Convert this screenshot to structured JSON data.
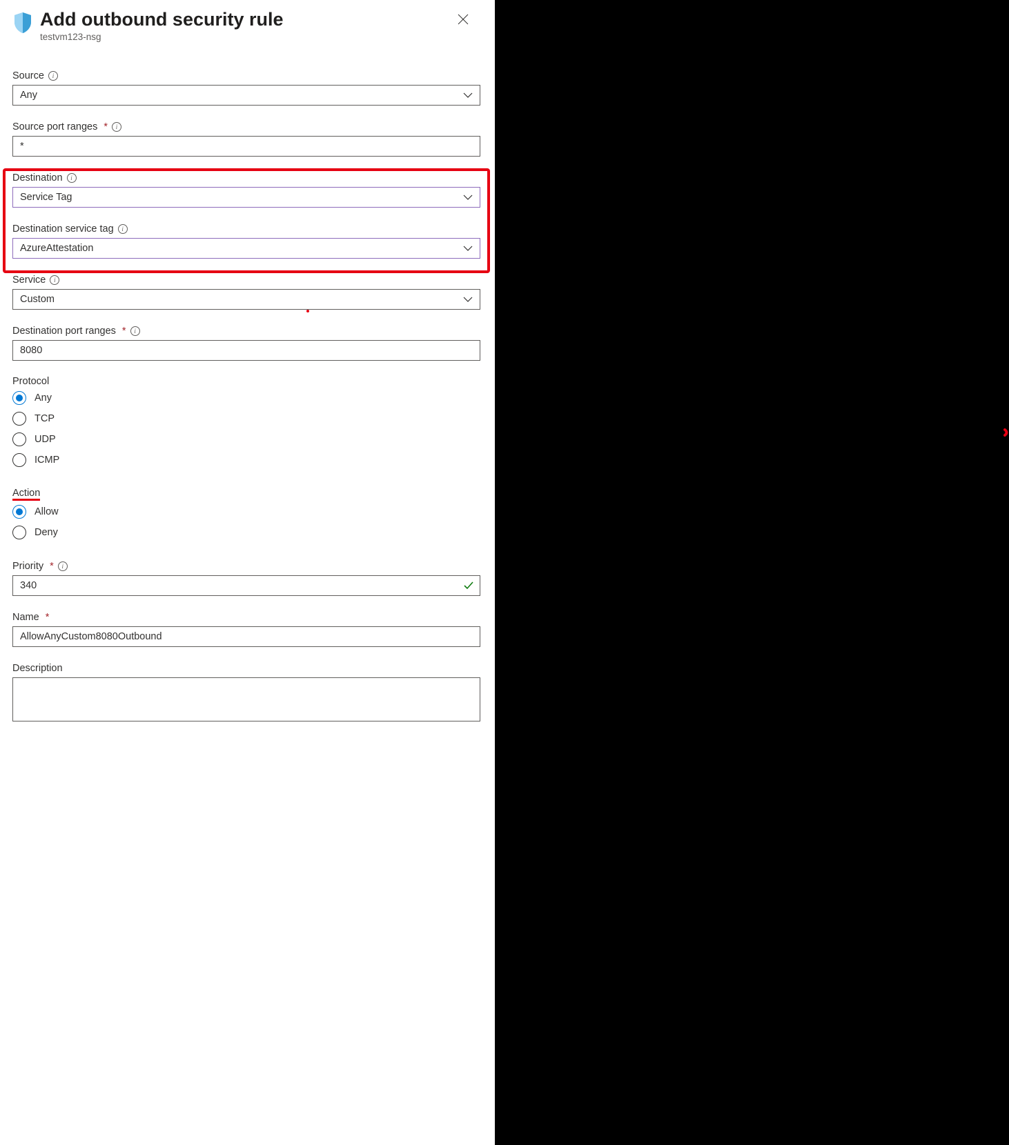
{
  "header": {
    "title": "Add outbound security rule",
    "subtitle": "testvm123-nsg"
  },
  "fields": {
    "source": {
      "label": "Source",
      "value": "Any"
    },
    "source_port_ranges": {
      "label": "Source port ranges",
      "value": "*"
    },
    "destination": {
      "label": "Destination",
      "value": "Service Tag"
    },
    "destination_service_tag": {
      "label": "Destination service tag",
      "value": "AzureAttestation"
    },
    "service": {
      "label": "Service",
      "value": "Custom"
    },
    "destination_port_ranges": {
      "label": "Destination port ranges",
      "value": "8080"
    },
    "protocol": {
      "label": "Protocol",
      "options": [
        "Any",
        "TCP",
        "UDP",
        "ICMP"
      ],
      "selected": "Any"
    },
    "action": {
      "label": "Action",
      "options": [
        "Allow",
        "Deny"
      ],
      "selected": "Allow"
    },
    "priority": {
      "label": "Priority",
      "value": "340"
    },
    "name": {
      "label": "Name",
      "value": "AllowAnyCustom8080Outbound"
    },
    "description": {
      "label": "Description",
      "value": ""
    }
  }
}
